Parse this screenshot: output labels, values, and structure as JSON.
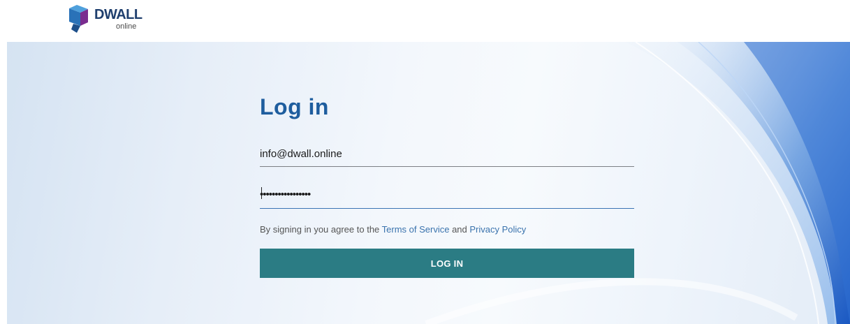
{
  "brand": {
    "logo_icon": "dwall-cube-icon",
    "name": "DWALL",
    "subtitle": "online"
  },
  "login": {
    "title": "Log in",
    "email_value": "info@dwall.online",
    "password_masked": "•••••••••••••••••",
    "agreement_prefix": "By signing in you agree to the ",
    "terms_link": "Terms of Service",
    "agreement_and": " and ",
    "privacy_link": "Privacy Policy",
    "submit_label": "LOG IN"
  },
  "colors": {
    "heading": "#1e5d9e",
    "button": "#2b7c84",
    "link": "#3a73ad",
    "wave_accent": "#1e62c8"
  }
}
